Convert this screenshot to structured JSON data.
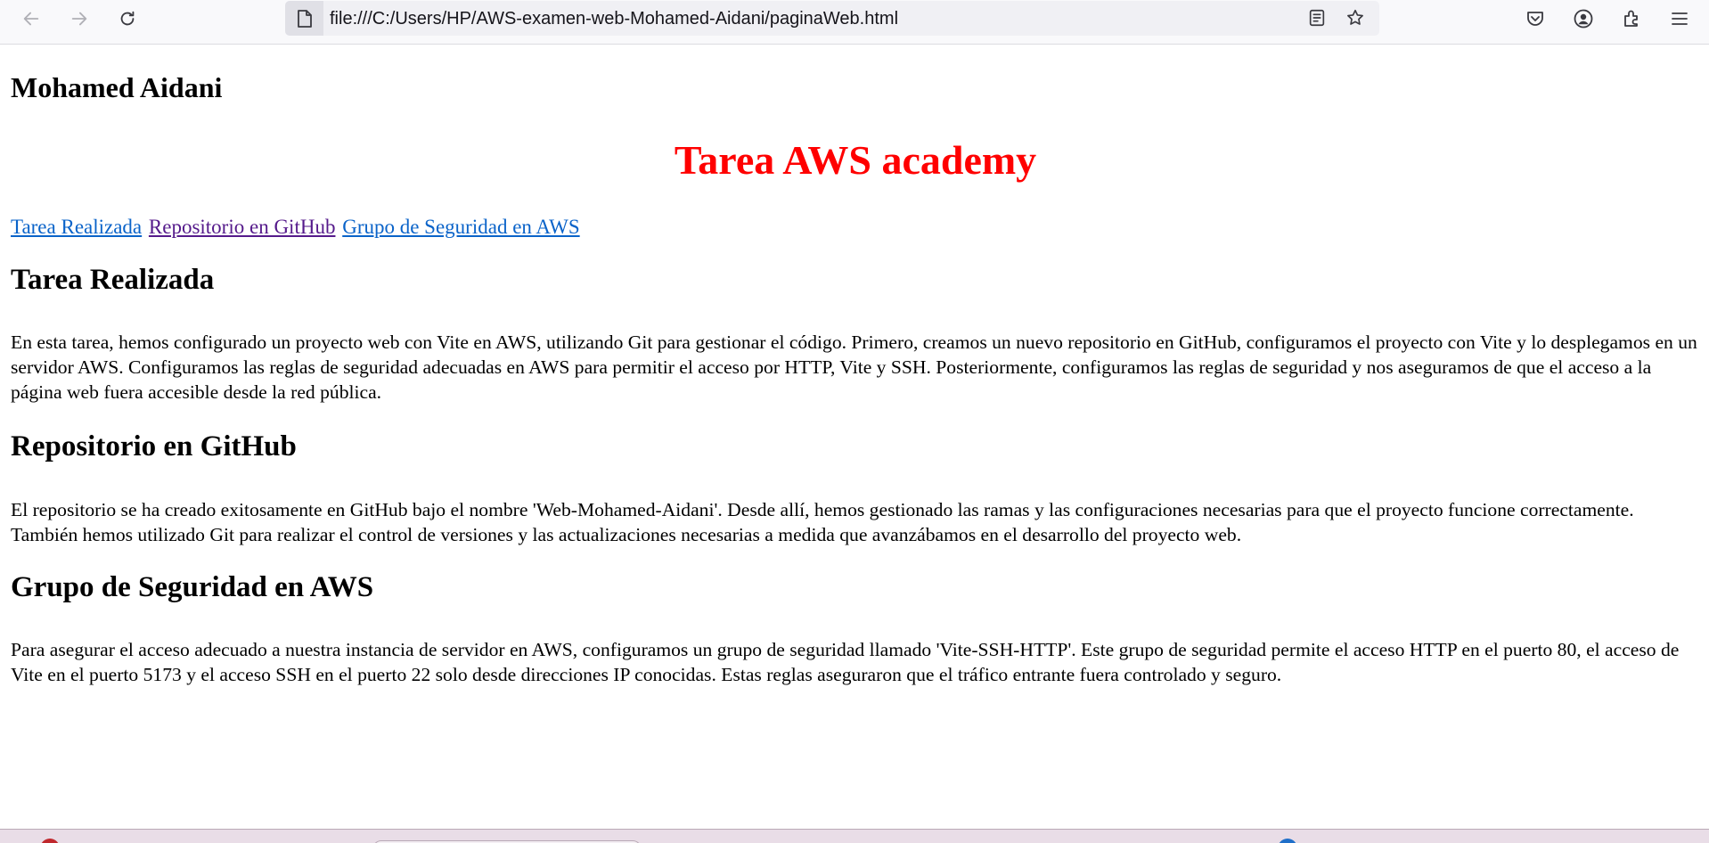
{
  "browser": {
    "url": "file:///C:/Users/HP/AWS-examen-web-Mohamed-Aidani/paginaWeb.html",
    "icons": {
      "back": "arrow-left-icon",
      "forward": "arrow-right-icon",
      "reload": "reload-icon",
      "site": "file-icon",
      "reader": "reader-view-icon",
      "bookmark": "star-icon",
      "pocket": "pocket-icon",
      "account": "account-icon",
      "extensions": "extensions-icon",
      "menu": "hamburger-menu-icon"
    }
  },
  "page": {
    "author": "Mohamed Aidani",
    "title": "Tarea AWS academy",
    "title_color": "#ff0000",
    "nav": [
      {
        "label": "Tarea Realizada"
      },
      {
        "label": "Repositorio en GitHub"
      },
      {
        "label": "Grupo de Seguridad en AWS"
      }
    ],
    "sections": [
      {
        "heading": "Tarea Realizada",
        "text": "En esta tarea, hemos configurado un proyecto web con Vite en AWS, utilizando Git para gestionar el código. Primero, creamos un nuevo repositorio en GitHub, configuramos el proyecto con Vite y lo desplegamos en un servidor AWS. Configuramos las reglas de seguridad adecuadas en AWS para permitir el acceso por HTTP, Vite y SSH. Posteriormente, configuramos las reglas de seguridad y nos aseguramos de que el acceso a la página web fuera accesible desde la red pública."
      },
      {
        "heading": "Repositorio en GitHub",
        "text": "El repositorio se ha creado exitosamente en GitHub bajo el nombre 'Web-Mohamed-Aidani'. Desde allí, hemos gestionado las ramas y las configuraciones necesarias para que el proyecto funcione correctamente. También hemos utilizado Git para realizar el control de versiones y las actualizaciones necesarias a medida que avanzábamos en el desarrollo del proyecto web."
      },
      {
        "heading": "Grupo de Seguridad en AWS",
        "text": "Para asegurar el acceso adecuado a nuestra instancia de servidor en AWS, configuramos un grupo de seguridad llamado 'Vite-SSH-HTTP'. Este grupo de seguridad permite el acceso HTTP en el puerto 80, el acceso de Vite en el puerto 5173 y el acceso SSH en el puerto 22 solo desde direcciones IP conocidas. Estas reglas aseguraron que el tráfico entrante fuera controlado y seguro."
      }
    ]
  },
  "colors": {
    "link": "#0a63c9",
    "link_visited": "#551a8b",
    "toolbar_bg": "#f9f9fb",
    "urlbar_bg": "#f0f0f4"
  }
}
